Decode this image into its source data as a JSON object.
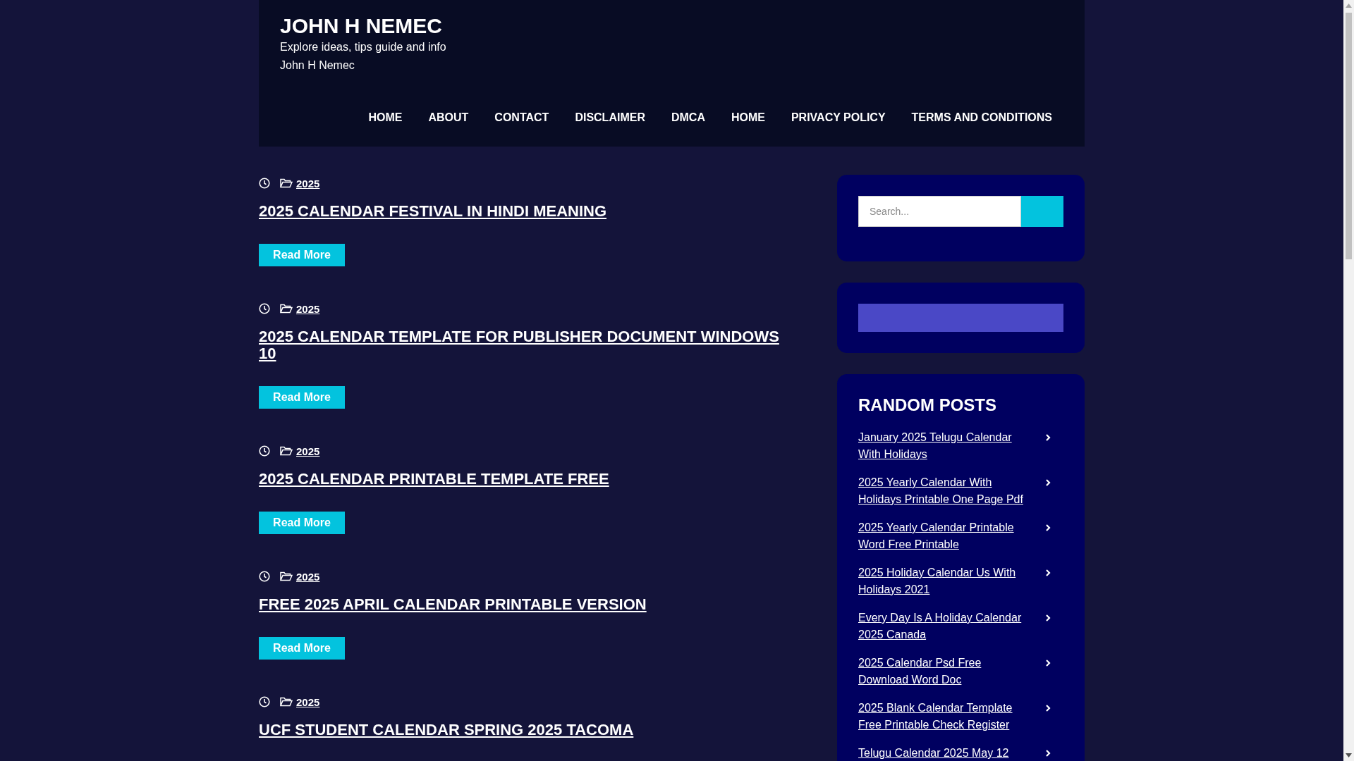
{
  "site": {
    "title": "JOHN H NEMEC",
    "tagline": "Explore ideas, tips guide and info",
    "author": "John H Nemec"
  },
  "nav": [
    "HOME",
    "ABOUT",
    "CONTACT",
    "DISCLAIMER",
    "DMCA",
    "HOME",
    "PRIVACY POLICY",
    "TERMS AND CONDITIONS"
  ],
  "posts": [
    {
      "category": "2025",
      "title": "2025 CALENDAR FESTIVAL IN HINDI MEANING",
      "button": "Read More"
    },
    {
      "category": "2025",
      "title": "2025 CALENDAR TEMPLATE FOR PUBLISHER DOCUMENT WINDOWS 10",
      "button": "Read More"
    },
    {
      "category": "2025",
      "title": "2025 CALENDAR PRINTABLE TEMPLATE FREE",
      "button": "Read More"
    },
    {
      "category": "2025",
      "title": "FREE 2025 APRIL CALENDAR PRINTABLE VERSION",
      "button": "Read More"
    },
    {
      "category": "2025",
      "title": "UCF STUDENT CALENDAR SPRING 2025 TACOMA"
    }
  ],
  "search": {
    "placeholder": "Search..."
  },
  "random_posts": {
    "heading": "RANDOM POSTS",
    "items": [
      "January 2025 Telugu Calendar With Holidays",
      "2025 Yearly Calendar With Holidays Printable One Page Pdf",
      "2025 Yearly Calendar Printable Word Free Printable",
      "2025 Holiday Calendar Us With Holidays 2021",
      "Every Day Is A Holiday Calendar 2025 Canada",
      "2025 Calendar Psd Free Download Word Doc",
      "2025 Blank Calendar Template Free Printable Check Register",
      "Telugu Calendar 2025 May 12"
    ]
  }
}
